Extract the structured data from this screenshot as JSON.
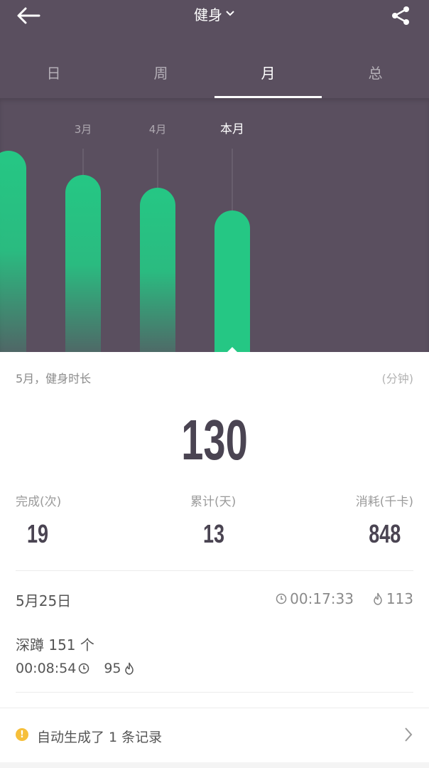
{
  "header": {
    "title": "健身"
  },
  "tabs": [
    {
      "label": "日",
      "active": false
    },
    {
      "label": "周",
      "active": false
    },
    {
      "label": "月",
      "active": true
    },
    {
      "label": "总",
      "active": false
    }
  ],
  "chart_data": {
    "type": "bar",
    "categories": [
      "",
      "3月",
      "4月",
      "本月"
    ],
    "selected_category": "本月",
    "bar_color": "#25c784",
    "selected_bar_color": "#25c784",
    "unit": "分钟",
    "values": [
      null,
      null,
      null,
      130
    ]
  },
  "summary": {
    "caption": "5月，健身时长",
    "unit": "(分钟)",
    "total_minutes": "130",
    "stats": [
      {
        "label": "完成(次)",
        "value": "19"
      },
      {
        "label": "累计(天)",
        "value": "13"
      },
      {
        "label": "消耗(千卡)",
        "value": "848"
      }
    ]
  },
  "record": {
    "date": "5月25日",
    "duration": "00:17:33",
    "calories": "113",
    "exercise_name": "深蹲 151 个",
    "exercise_duration": "00:08:54",
    "exercise_calories": "95"
  },
  "notice": {
    "text": "自动生成了 1 条记录"
  },
  "colors": {
    "header_bg": "#5a4f5f",
    "accent_green": "#25c784",
    "warn_yellow": "#f6bf3a"
  }
}
